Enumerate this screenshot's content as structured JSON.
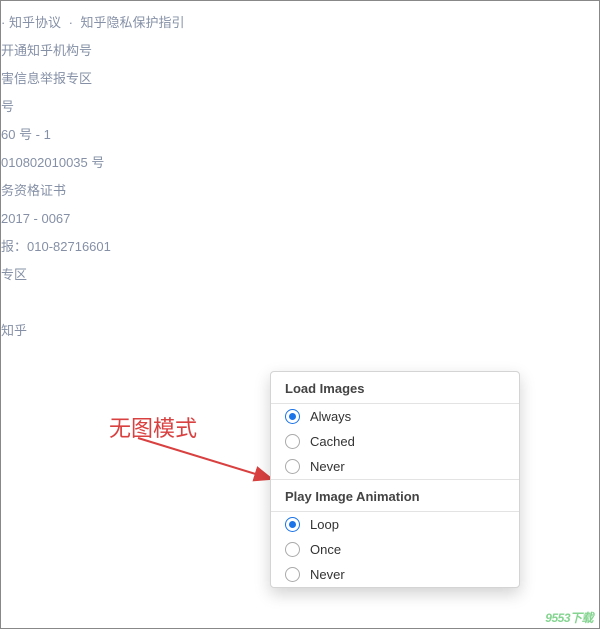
{
  "footer": {
    "line1_a": "· 知乎协议",
    "line1_sep": "·",
    "line1_b": "知乎隐私保护指引",
    "line2": "开通知乎机构号",
    "line3": "害信息举报专区",
    "line4": "号",
    "line5": "60 号 - 1",
    "line6": "010802010035 号",
    "line7": "务资格证书",
    "line8": "2017 - 0067",
    "line9": "报：010-82716601",
    "line10": "专区",
    "line11": "知乎"
  },
  "annotation": {
    "label": "无图模式"
  },
  "popup": {
    "section1": {
      "title": "Load Images",
      "options": [
        {
          "label": "Always",
          "selected": true
        },
        {
          "label": "Cached",
          "selected": false
        },
        {
          "label": "Never",
          "selected": false
        }
      ]
    },
    "section2": {
      "title": "Play Image Animation",
      "options": [
        {
          "label": "Loop",
          "selected": true
        },
        {
          "label": "Once",
          "selected": false
        },
        {
          "label": "Never",
          "selected": false
        }
      ]
    }
  },
  "watermark": {
    "text": "9553下载"
  }
}
